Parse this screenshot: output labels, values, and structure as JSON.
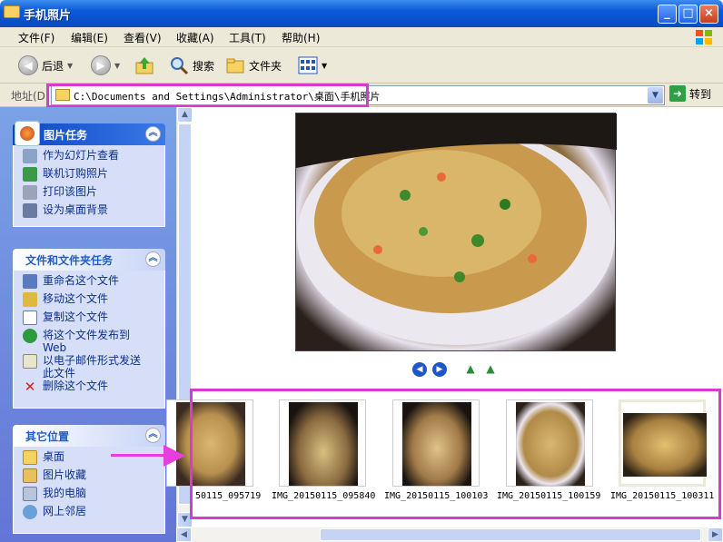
{
  "window": {
    "title": "手机照片",
    "minimize": "_",
    "maximize": "□",
    "close": "×"
  },
  "menu": [
    "文件(F)",
    "编辑(E)",
    "查看(V)",
    "收藏(A)",
    "工具(T)",
    "帮助(H)"
  ],
  "toolbar": {
    "back": "后退",
    "search": "搜索",
    "folders": "文件夹"
  },
  "address": {
    "label": "地址(D)",
    "path": "C:\\Documents and Settings\\Administrator\\桌面\\手机照片",
    "go": "转到"
  },
  "panels": {
    "picture_tasks": {
      "title": "图片任务",
      "items": [
        "作为幻灯片查看",
        "联机订购照片",
        "打印该图片",
        "设为桌面背景"
      ]
    },
    "file_tasks": {
      "title": "文件和文件夹任务",
      "items": [
        "重命名这个文件",
        "移动这个文件",
        "复制这个文件",
        "将这个文件发布到 Web",
        "以电子邮件形式发送此文件",
        "删除这个文件"
      ]
    },
    "other_places": {
      "title": "其它位置",
      "items": [
        "桌面",
        "图片收藏",
        "我的电脑",
        "网上邻居"
      ]
    }
  },
  "thumbnails": [
    {
      "caption": "50115_095719"
    },
    {
      "caption": "IMG_20150115_095840"
    },
    {
      "caption": "IMG_20150115_100103"
    },
    {
      "caption": "IMG_20150115_100159"
    },
    {
      "caption": "IMG_20150115_100311"
    }
  ],
  "colors": {
    "highlight": "#d63ad0",
    "titlebar": "#0a5ad8",
    "taskpane": "#6375d6"
  }
}
